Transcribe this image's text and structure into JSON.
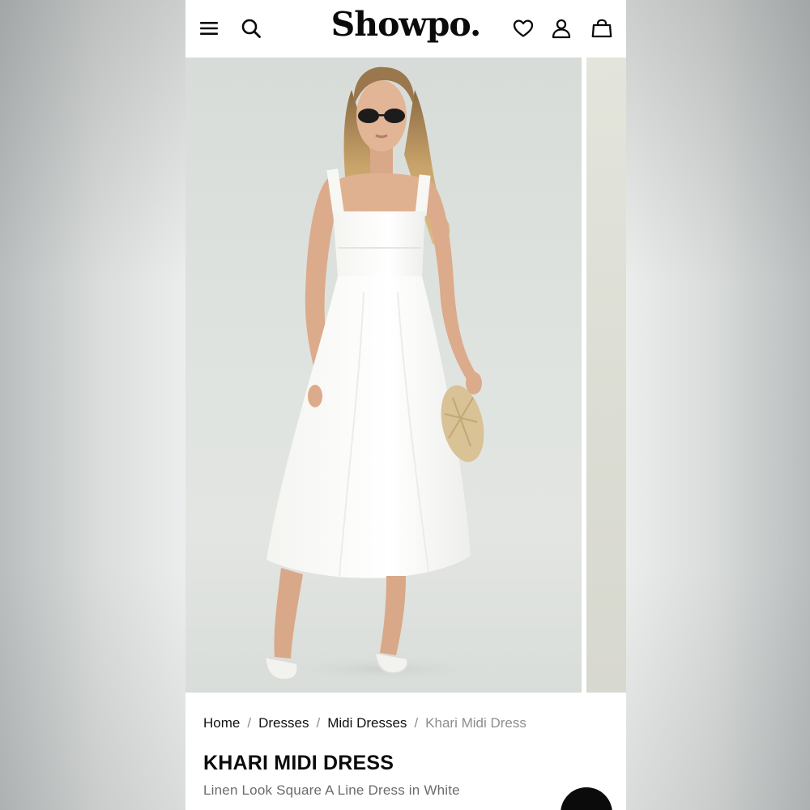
{
  "header": {
    "logo": "Showpo.",
    "icons": [
      "menu-icon",
      "search-icon",
      "heart-icon",
      "user-icon",
      "bag-icon"
    ]
  },
  "gallery": {
    "image_description_icon": "product-photo"
  },
  "breadcrumb": {
    "items": [
      "Home",
      "Dresses",
      "Midi Dresses"
    ],
    "current": "Khari Midi Dress",
    "separator": "/"
  },
  "product": {
    "title": "KHARI MIDI DRESS",
    "subtitle": "Linen Look Square A Line Dress in White"
  },
  "chat": {
    "icon": "chat-icon"
  },
  "colors": {
    "text": "#0b0b0b",
    "muted": "#8d8d8d",
    "fab": "#0b0b0b"
  }
}
